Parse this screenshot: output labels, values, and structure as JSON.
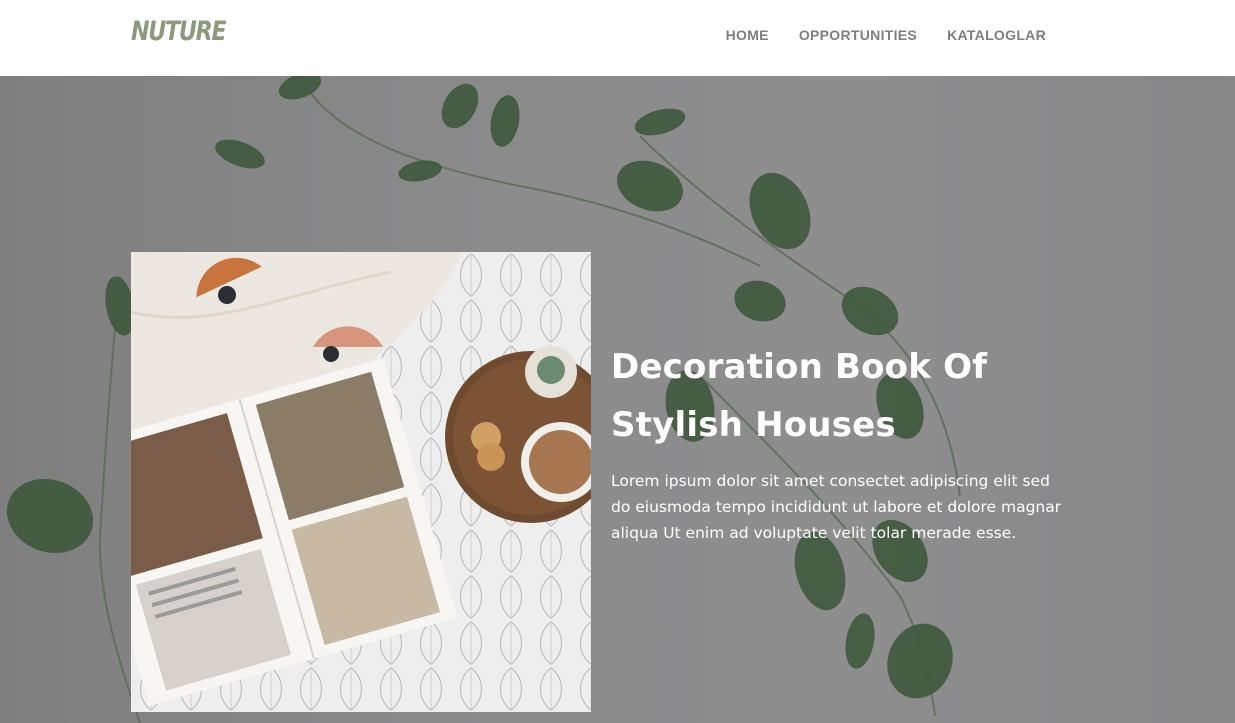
{
  "brand": {
    "logo_text": "NUTURE"
  },
  "nav": {
    "items": [
      {
        "label": "HOME"
      },
      {
        "label": "OPPORTUNITIES"
      },
      {
        "label": "KATALOGLAR"
      }
    ]
  },
  "hero": {
    "title": "Decoration Book Of Stylish Houses",
    "description": "Lorem ipsum dolor sit amet consectet adipiscing elit sed do eiusmoda tempo incididunt ut labore et dolore magnar aliqua Ut enim ad voluptate velit tolar merade esse.",
    "image_icon": "magazine-photo"
  },
  "colors": {
    "logo": "#8a9a7b",
    "nav_text": "#7e7e7e",
    "hero_overlay": "#8a8a8a",
    "leaf": "#3e5a3c"
  }
}
